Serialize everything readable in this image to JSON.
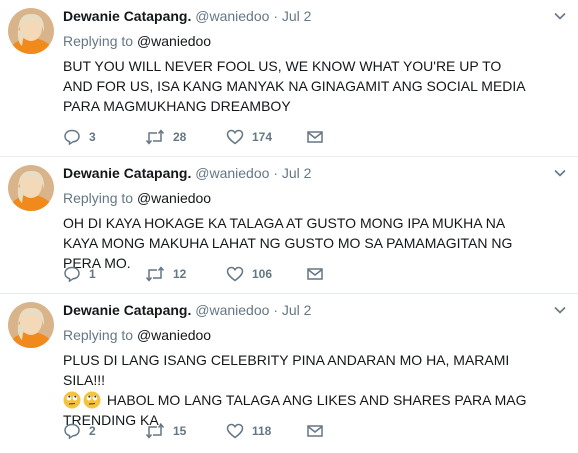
{
  "tweets": [
    {
      "name": "Dewanie Catapang.",
      "handle": "@waniedoo",
      "separator": "·",
      "date": "Jul 2",
      "replying_prefix": "Replying to",
      "replying_to": "@waniedoo",
      "text": "BUT YOU WILL NEVER FOOL US, WE KNOW WHAT YOU'RE UP TO AND FOR US, ISA KANG MANYAK NA GINAGAMIT ANG SOCIAL MEDIA PARA MAGMUKHANG DREAMBOY",
      "replies": "3",
      "retweets": "28",
      "likes": "174"
    },
    {
      "name": "Dewanie Catapang.",
      "handle": "@waniedoo",
      "separator": "·",
      "date": "Jul 2",
      "replying_prefix": "Replying to",
      "replying_to": "@waniedoo",
      "text": "OH DI KAYA HOKAGE KA TALAGA AT GUSTO MONG IPA MUKHA NA KAYA MONG MAKUHA LAHAT NG GUSTO MO SA PAMAMAGITAN NG PERA MO.",
      "replies": "1",
      "retweets": "12",
      "likes": "106"
    },
    {
      "name": "Dewanie Catapang.",
      "handle": "@waniedoo",
      "separator": "·",
      "date": "Jul 2",
      "replying_prefix": "Replying to",
      "replying_to": "@waniedoo",
      "text_line1": "PLUS DI LANG ISANG CELEBRITY PINA ANDARAN MO HA, MARAMI SILA!!!",
      "text_line2": "HABOL MO LANG TALAGA ANG LIKES AND SHARES PARA MAG TRENDING KA.",
      "emoji_icon": "rolling-eyes-emoji",
      "replies": "2",
      "retweets": "15",
      "likes": "118"
    }
  ],
  "colors": {
    "text": "#14171a",
    "secondary": "#657786",
    "divider": "#e6ecf0",
    "avatar_bg": "#e8a05a"
  },
  "icons": [
    "reply-icon",
    "retweet-icon",
    "like-icon",
    "message-icon",
    "caret-down-icon"
  ]
}
